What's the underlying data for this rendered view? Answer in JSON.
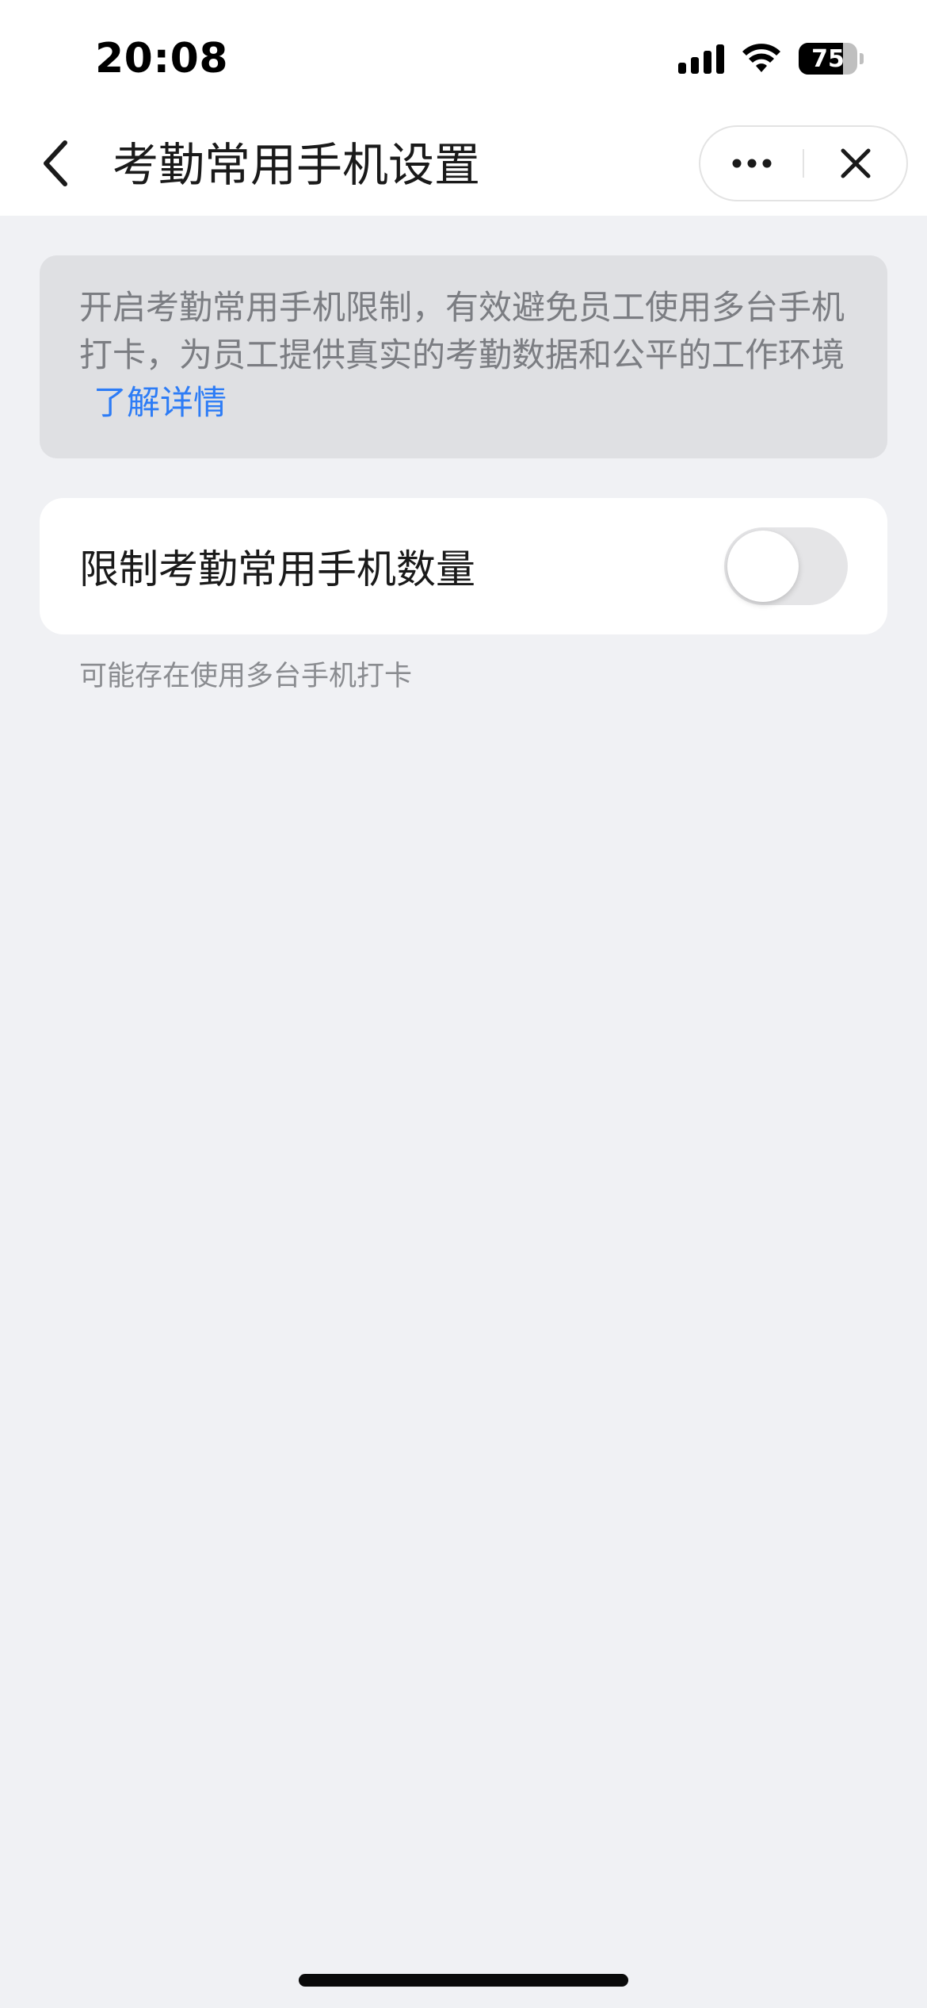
{
  "status_bar": {
    "time": "20:08",
    "battery_percent": "75",
    "battery_level": 0.75,
    "icons": [
      "signal-icon",
      "wifi-icon",
      "battery-icon"
    ]
  },
  "nav": {
    "title": "考勤常用手机设置",
    "back_icon": "chevron-left-icon",
    "more_icon": "more-dots-icon",
    "close_icon": "close-icon"
  },
  "notice": {
    "text": "开启考勤常用手机限制，有效避免员工使用多台手机打卡，为员工提供真实的考勤数据和公平的工作环境",
    "link_label": "了解详情"
  },
  "setting": {
    "label": "限制考勤常用手机数量",
    "enabled": false,
    "hint": "可能存在使用多台手机打卡"
  },
  "colors": {
    "background": "#f0f1f4",
    "link": "#2d7cf6",
    "notice_bg": "#dfe0e3",
    "toggle_off": "#e5e5e7"
  }
}
